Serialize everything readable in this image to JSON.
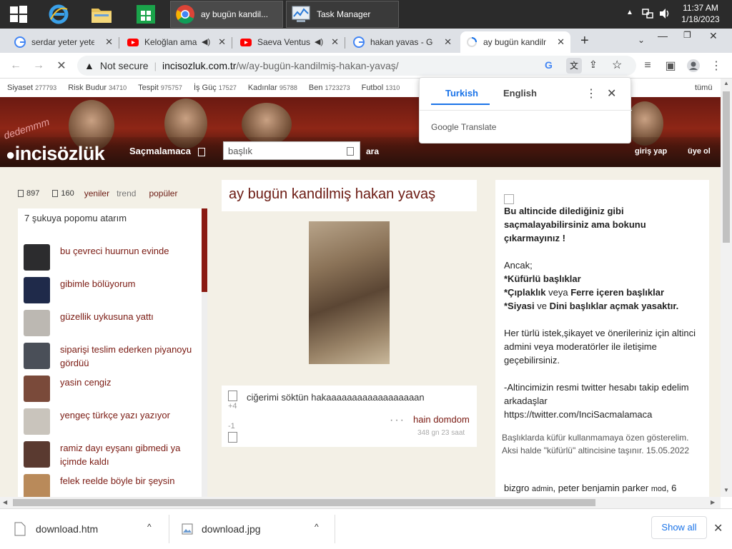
{
  "taskbar": {
    "apps": [
      {
        "name": "Google Chrome",
        "label": "ay bugün kandil..."
      },
      {
        "name": "Task Manager",
        "label": "Task Manager"
      }
    ],
    "clock": {
      "time": "11:37 AM",
      "date": "1/18/2023"
    }
  },
  "tabs": [
    {
      "title": "serdar yeter yeter",
      "favicon": "google-icon"
    },
    {
      "title": "Keloğlan ama",
      "favicon": "youtube-icon"
    },
    {
      "title": "Saeva Ventus",
      "favicon": "youtube-icon"
    },
    {
      "title": "hakan yavas - Go",
      "favicon": "google-icon"
    },
    {
      "title": "ay bugün kandilm",
      "favicon": "loading-icon",
      "active": true
    }
  ],
  "omnibox": {
    "security": "Not secure",
    "domain": "incisozluk.com.tr",
    "path": "/w/ay-bugün-kandilmiş-hakan-yavaş/"
  },
  "categories": [
    {
      "name": "Siyaset",
      "count": "277793"
    },
    {
      "name": "Risk Budur",
      "count": "34710"
    },
    {
      "name": "Tespit",
      "count": "975757"
    },
    {
      "name": "İş Güç",
      "count": "17527"
    },
    {
      "name": "Kadınlar",
      "count": "95788"
    },
    {
      "name": "Ben",
      "count": "1723273"
    },
    {
      "name": "Futbol",
      "count": "1310"
    }
  ],
  "categories_all": "tümü",
  "site": {
    "logo": "incisözlük",
    "logo_overlay": "dedemmm",
    "category_selector": "Saçmalamaca",
    "search_placeholder": "başlık",
    "search_button": "ara",
    "login": "giriş yap",
    "register": "üye ol"
  },
  "left": {
    "count1": "897",
    "count2": "160",
    "tabs": [
      "yeniler",
      "trend",
      "popüler"
    ],
    "top_item": "7 şukuya popomu atarım",
    "items": [
      {
        "text": "bu çevreci huurnun evinde",
        "thumb": "#2c2c2e"
      },
      {
        "text": "gibimle bölüyorum",
        "thumb": "#1f2a4a"
      },
      {
        "text": "güzellik uykusuna yattı",
        "thumb": "#bcb8b2"
      },
      {
        "text": "siparişi teslim ederken piyanoyu gördüü",
        "thumb": "#4a4f58"
      },
      {
        "text": "yasin cengiz",
        "thumb": "#7a4a3a"
      },
      {
        "text": "yengeç türkçe yazı yazıyor",
        "thumb": "#c9c4bc"
      },
      {
        "text": "ramiz dayı eyşanı gibmedi ya içimde kaldı",
        "thumb": "#5a3a30"
      },
      {
        "text": "felek reelde böyle bir şeysin",
        "thumb": "#b98a5a"
      }
    ]
  },
  "topic": {
    "title": "ay bugün kandilmiş hakan yavaş",
    "entry": {
      "text": "ciğerimi söktün hakaaaaaaaaaaaaaaaaaan",
      "upvotes": "+4",
      "downvotes": "-1",
      "author": "hain domdom",
      "time": "348 gn 23 saat"
    }
  },
  "sidebar": {
    "bold_intro": "Bu altincide dilediğiniz gibi saçmalayabilirsiniz ama bokunu çıkarmayınız !",
    "ancak": "Ancak;",
    "rule1": "*Küfürlü başlıklar",
    "rule2_a": "*Çıplaklık",
    "rule2_b": " veya ",
    "rule2_c": "Ferre içeren başlıklar",
    "rule3_a": "*Siyasi",
    "rule3_b": " ve ",
    "rule3_c": "Dini başlıklar açmak yasaktır.",
    "para1": "Her türlü istek,şikayet ve önerileriniz için altinci admini veya moderatörler ile iletişime geçebilirsiniz.",
    "para2": "-Altincimizin resmi twitter hesabı takip edelim arkadaşlar",
    "twitter": "https://twitter.com/InciSacmalamaca",
    "notice": "Başlıklarda küfür kullanmamaya özen gösterelim. Aksi halde \"küfürlü\" altincisine taşınır. 15.05.2022",
    "mods_a": "bizgro",
    "mods_b": "admin",
    "mods_c": ", peter benjamin parker",
    "mods_d": "mod",
    "mods_e": ", 6"
  },
  "translate": {
    "lang_from": "Turkish",
    "lang_to": "English",
    "brand": "Google Translate"
  },
  "downloads": {
    "items": [
      {
        "name": "download.htm"
      },
      {
        "name": "download.jpg"
      }
    ],
    "show_all": "Show all"
  },
  "colors": {
    "accent": "#8a1a12",
    "chrome_blue": "#1a73e8"
  }
}
